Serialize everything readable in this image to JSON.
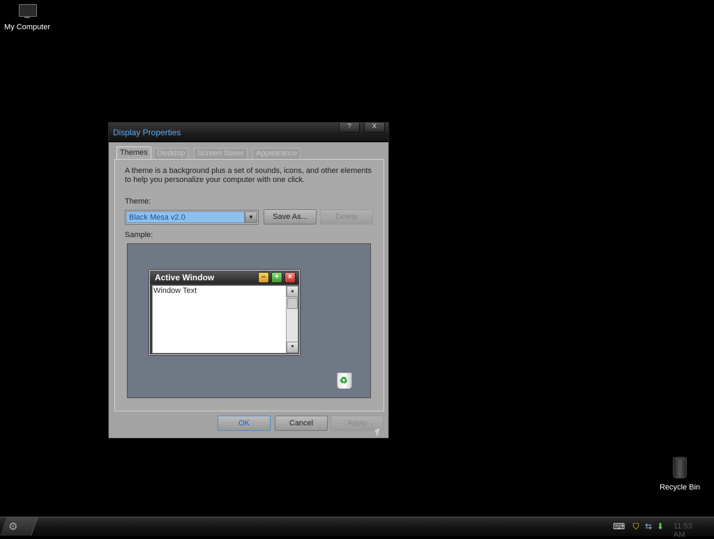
{
  "desktop": {
    "icons": [
      {
        "label": "My Computer",
        "icon": "monitor-icon"
      },
      {
        "label": "Recycle Bin",
        "icon": "recycle-bin-icon"
      }
    ]
  },
  "dialog": {
    "title": "Display Properties",
    "title_buttons": {
      "help": "?",
      "close": "X"
    },
    "tabs": [
      "Themes",
      "Desktop",
      "Screen Saver",
      "Appearance"
    ],
    "active_tab": "Themes",
    "description": "A theme is a background plus a set of sounds, icons, and other elements to help you personalize your computer with one click.",
    "theme_label": "Theme:",
    "theme_value": "Black Mesa v2.0",
    "save_as_label": "Save As...",
    "delete_label": "Delete",
    "sample_label": "Sample:",
    "sample": {
      "window_title": "Active Window",
      "window_text": "Window Text"
    },
    "ok_label": "OK",
    "cancel_label": "Cancel",
    "apply_label": "Apply"
  },
  "taskbar": {
    "clock": "11:53 AM"
  },
  "colors": {
    "title_text": "#5aaaf0",
    "desktop_bg": "#000000",
    "dialog_bg": "#a3a3a3",
    "sample_bg": "#707886"
  }
}
